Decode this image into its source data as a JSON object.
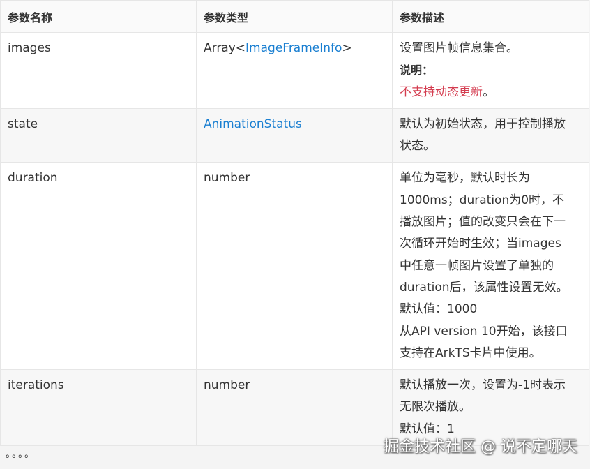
{
  "table": {
    "headers": [
      "参数名称",
      "参数类型",
      "参数描述"
    ],
    "rows": [
      {
        "name": "images",
        "type_prefix": "Array<",
        "type_link": "ImageFrameInfo",
        "type_suffix": ">",
        "desc": "设置图片帧信息集合。",
        "note_title": "说明：",
        "note_text": "不支持动态更新",
        "note_end": "。"
      },
      {
        "name": "state",
        "type_link": "AnimationStatus",
        "desc_lines": [
          "默认为初始状态，用于控制播放",
          "状态。"
        ]
      },
      {
        "name": "duration",
        "type": "number",
        "desc_lines": [
          "单位为毫秒，默认时长为",
          "1000ms；duration为0时，不",
          "播放图片；值的改变只会在下一",
          "次循环开始时生效；当images",
          "中任意一帧图片设置了单独的",
          "duration后，该属性设置无效。",
          "默认值：1000",
          "从API version 10开始，该接口",
          "支持在ArkTS卡片中使用。"
        ]
      },
      {
        "name": "iterations",
        "type": "number",
        "desc_lines": [
          "默认播放一次，设置为-1时表示",
          "无限次播放。",
          "默认值：1"
        ]
      }
    ]
  },
  "footer": {
    "ellipsis": "。。。。",
    "watermark": "掘金技术社区 @ 说不定哪天"
  },
  "colors": {
    "link": "#1a7fd1",
    "note_red": "#d43d50",
    "border": "#e6e6e6"
  }
}
